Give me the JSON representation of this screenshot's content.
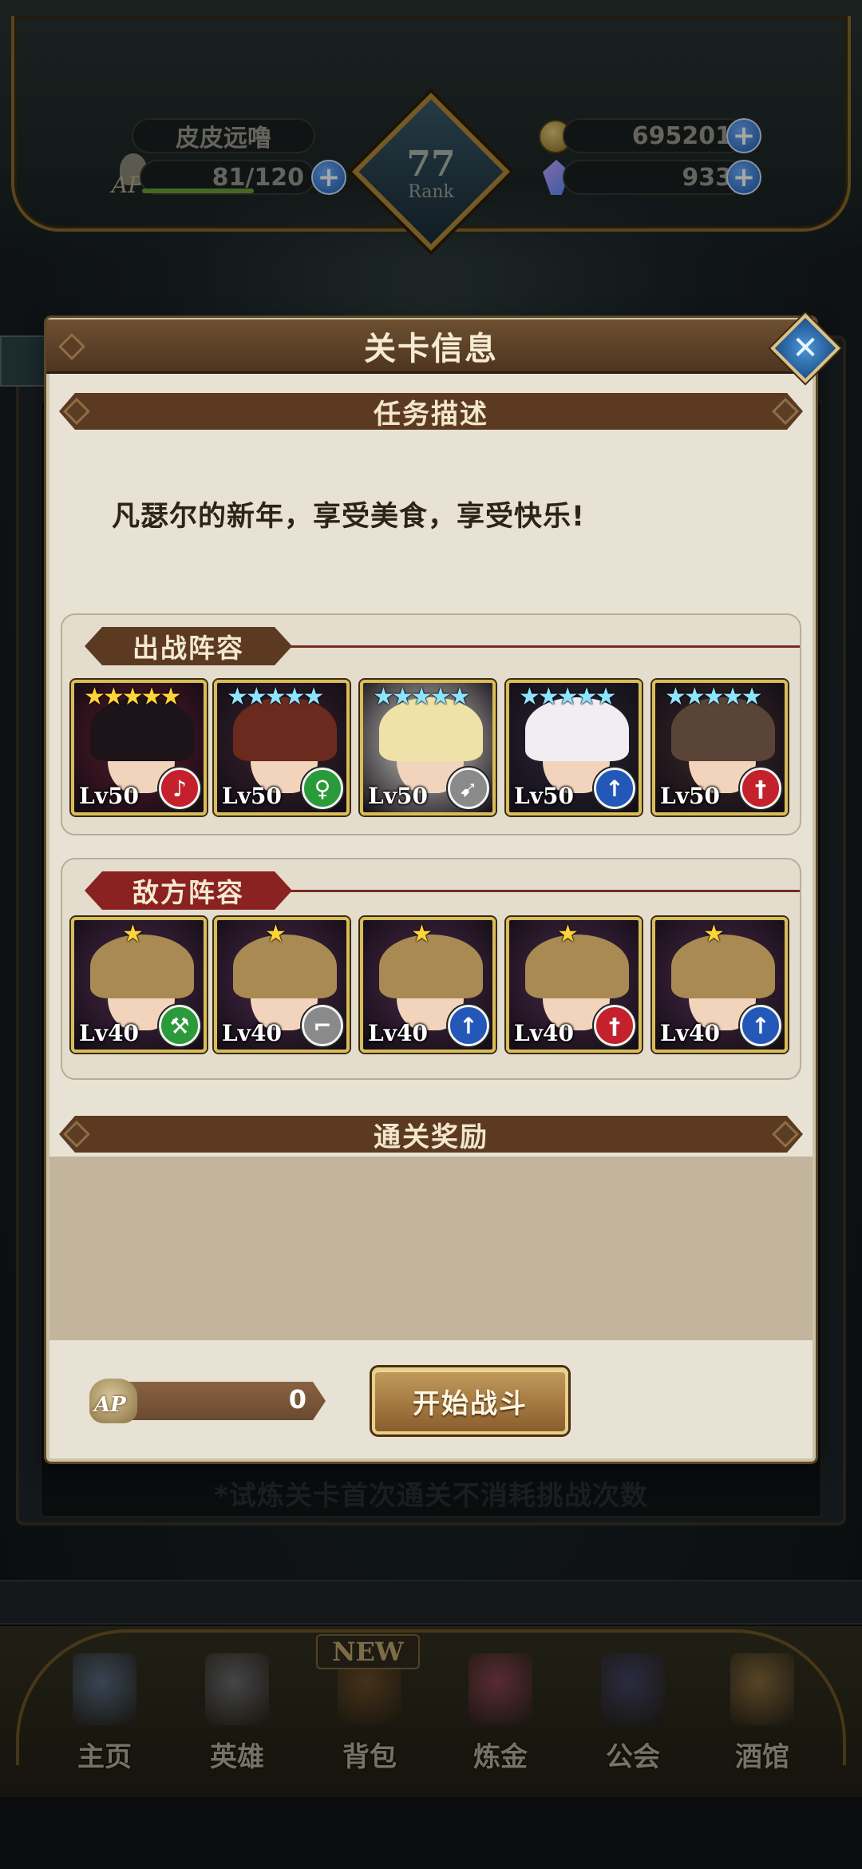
{
  "hud": {
    "player_name": "皮皮远噜",
    "ap_label": "AP",
    "ap_value": "81/120",
    "rank_value": "77",
    "rank_label": "Rank",
    "gold": "695201",
    "gems": "933",
    "plus_symbol": "+"
  },
  "dialog": {
    "title": "关卡信息",
    "close_symbol": "✕",
    "mission_header": "任务描述",
    "mission_text": "凡瑟尔的新年，享受美食，享受快乐!",
    "ally_header": "出战阵容",
    "enemy_header": "敌方阵容",
    "reward_header": "通关奖励",
    "ap_cost_label": "AP",
    "ap_cost_value": "0",
    "start_button": "开始战斗"
  },
  "allies": [
    {
      "level": "Lv50",
      "stars": "★★★★★",
      "star_color": "gold",
      "class": "harp-icon",
      "class_glyph": "♪",
      "class_color": "red",
      "hair": "#1c1418",
      "bg": "#5a1a2a"
    },
    {
      "level": "Lv50",
      "stars": "★★★★★",
      "star_color": "mixed",
      "class": "staff-icon",
      "class_glyph": "♀",
      "class_color": "green",
      "hair": "#6a2a1e",
      "bg": "#3a2430"
    },
    {
      "level": "Lv50",
      "stars": "★★★★★",
      "star_color": "mixed",
      "class": "bow-icon",
      "class_glyph": "➹",
      "class_color": "gray",
      "hair": "#efe2a8",
      "bg": "#d8d8d0"
    },
    {
      "level": "Lv50",
      "stars": "★★★★★",
      "star_color": "mixed",
      "class": "spear-icon",
      "class_glyph": "↑",
      "class_color": "blue",
      "hair": "#f0eef2",
      "bg": "#2a2a3a"
    },
    {
      "level": "Lv50",
      "stars": "★★★★★",
      "star_color": "mixed",
      "class": "sword-icon",
      "class_glyph": "†",
      "class_color": "red",
      "hair": "#5a4438",
      "bg": "#3a2a2a"
    }
  ],
  "enemies": [
    {
      "level": "Lv40",
      "stars": "★",
      "class": "axe-icon",
      "class_glyph": "⚒",
      "class_color": "green"
    },
    {
      "level": "Lv40",
      "stars": "★",
      "class": "gun-icon",
      "class_glyph": "⌐",
      "class_color": "gray"
    },
    {
      "level": "Lv40",
      "stars": "★",
      "class": "spear-icon",
      "class_glyph": "↑",
      "class_color": "blue"
    },
    {
      "level": "Lv40",
      "stars": "★",
      "class": "sword-icon",
      "class_glyph": "†",
      "class_color": "red"
    },
    {
      "level": "Lv40",
      "stars": "★",
      "class": "spear-icon",
      "class_glyph": "↑",
      "class_color": "blue"
    }
  ],
  "trial_note": "*试炼关卡首次通关不消耗挑战次数",
  "nav": {
    "new_badge": "NEW",
    "items": [
      {
        "label": "主页",
        "icon": "castle-icon",
        "color": "#6a8ab8"
      },
      {
        "label": "英雄",
        "icon": "helmet-icon",
        "color": "#8a8a9a"
      },
      {
        "label": "背包",
        "icon": "backpack-icon",
        "color": "#8a5a2a"
      },
      {
        "label": "炼金",
        "icon": "flask-icon",
        "color": "#b84a6a"
      },
      {
        "label": "公会",
        "icon": "guild-crest-icon",
        "color": "#4a4a8a"
      },
      {
        "label": "酒馆",
        "icon": "tavern-mug-icon",
        "color": "#b8884a"
      }
    ]
  }
}
